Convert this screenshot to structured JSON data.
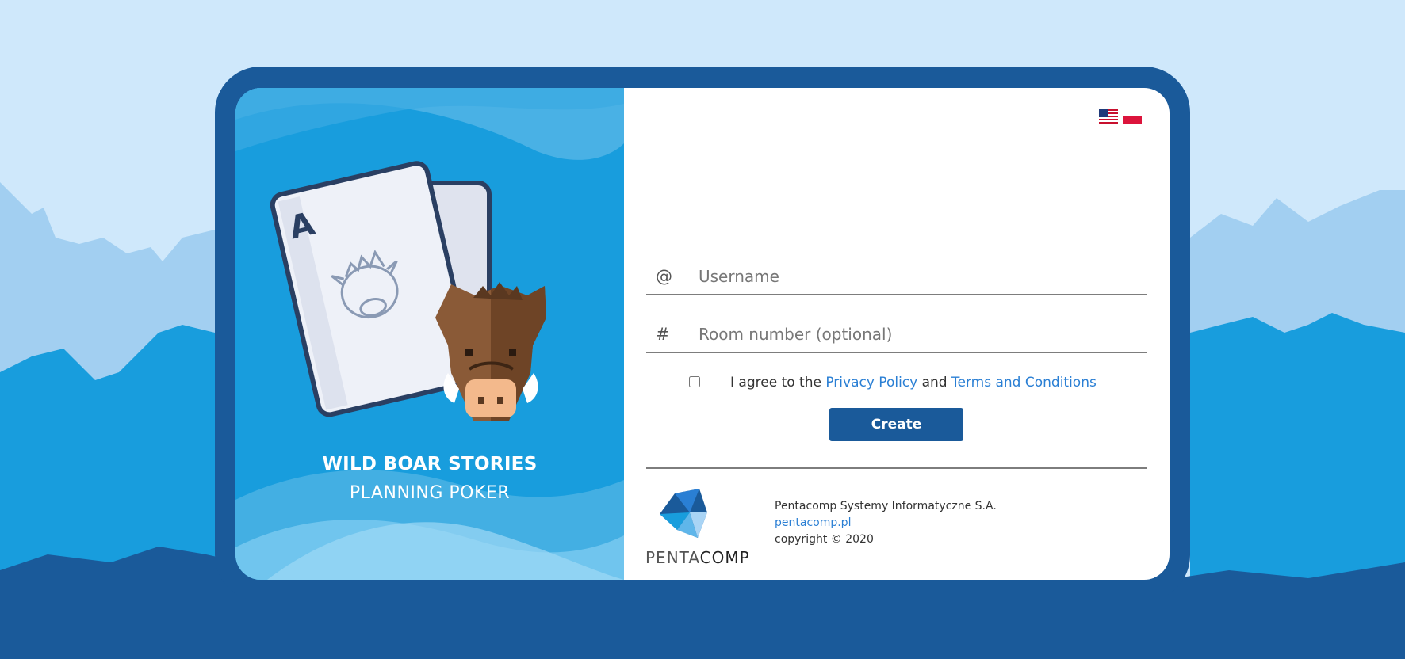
{
  "brand": {
    "title": "WILD BOAR STORIES",
    "subtitle": "PLANNING POKER",
    "card_letter": "A"
  },
  "languages": [
    {
      "code": "en",
      "icon": "us-flag-icon"
    },
    {
      "code": "pl",
      "icon": "pl-flag-icon"
    }
  ],
  "form": {
    "username_prefix": "@",
    "username_placeholder": "Username",
    "room_prefix": "#",
    "room_placeholder": "Room number (optional)",
    "agree_text_1": "I agree to the ",
    "privacy_link": "Privacy Policy",
    "agree_text_2": " and ",
    "terms_link": "Terms and Conditions",
    "create_label": "Create"
  },
  "footer": {
    "logo_text_light": "PENTA",
    "logo_text_bold": "COMP",
    "company_name": "Pentacomp Systemy Informatyczne S.A.",
    "website": "pentacomp.pl",
    "copyright": "copyright © 2020"
  },
  "colors": {
    "frame": "#1a5a9a",
    "panel": "#189ddd",
    "link": "#2a7fd4",
    "button": "#1a5a9a"
  }
}
